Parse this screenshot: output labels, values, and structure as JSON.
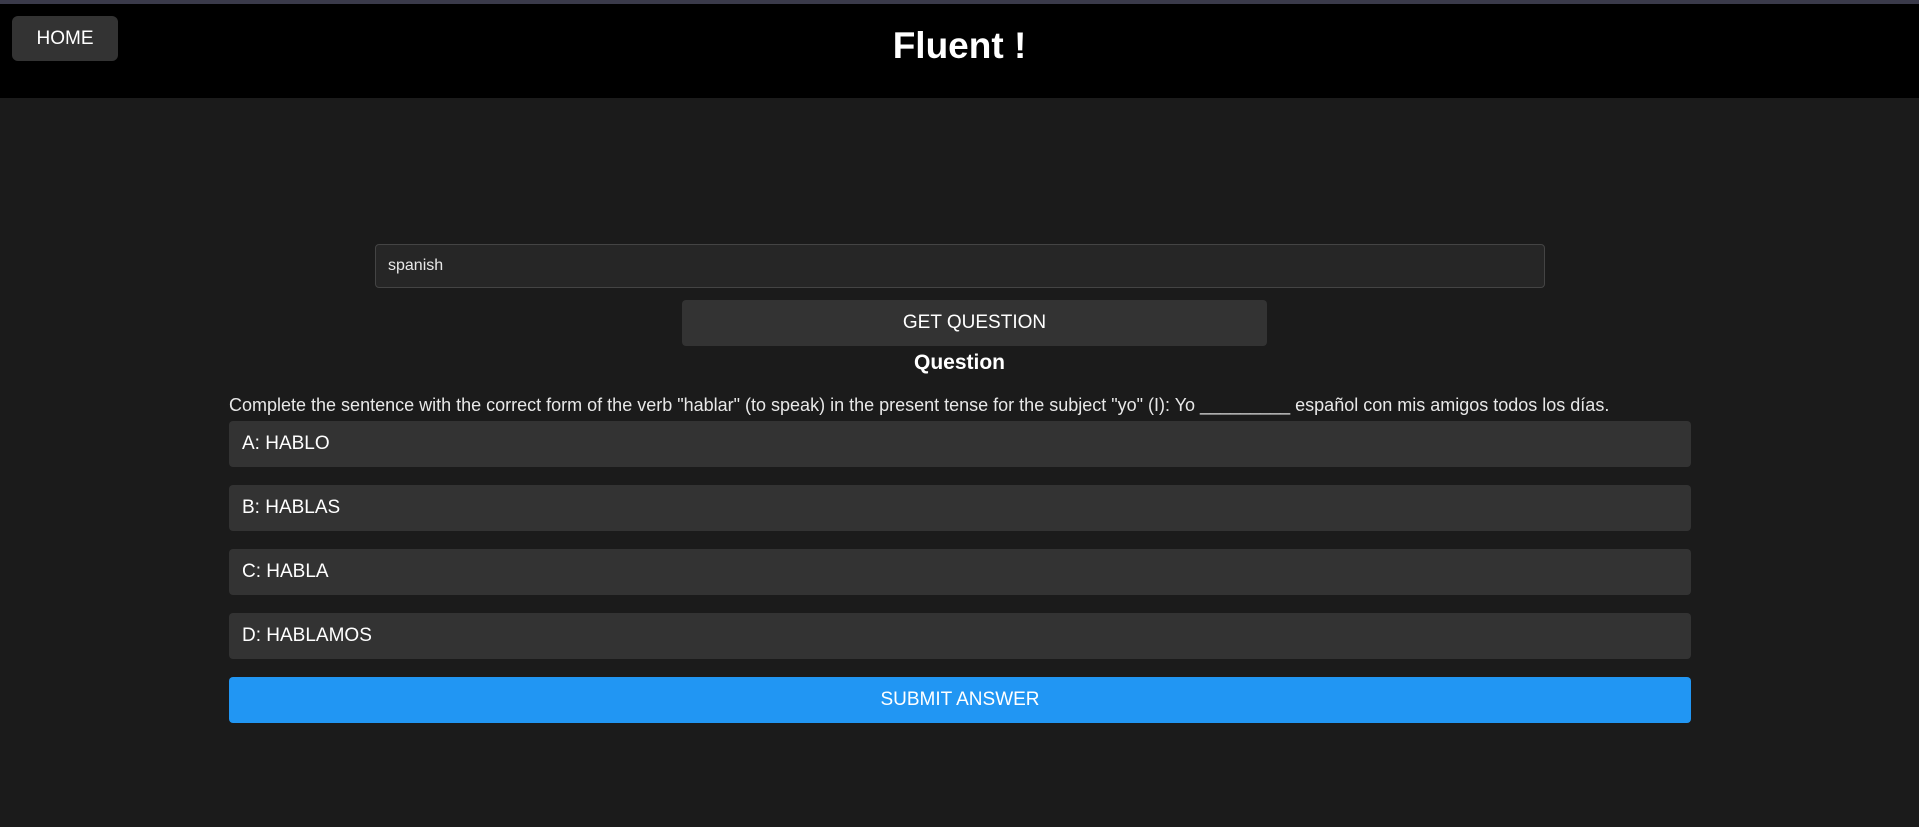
{
  "header": {
    "home_label": "HOME",
    "title": "Fluent !"
  },
  "language_input": {
    "value": "spanish"
  },
  "get_question_label": "GET QUESTION",
  "question": {
    "heading": "Question",
    "text": "Complete the sentence with the correct form of the verb \"hablar\" (to speak) in the present tense for the subject \"yo\" (I): Yo _________ español con mis amigos todos los días.",
    "options": [
      {
        "label": "A: HABLO"
      },
      {
        "label": "B: HABLAS"
      },
      {
        "label": "C: HABLA"
      },
      {
        "label": "D: HABLAMOS"
      }
    ]
  },
  "submit_label": "SUBMIT ANSWER",
  "colors": {
    "header_bg": "#000000",
    "page_bg": "#1b1b1b",
    "button_bg": "#333333",
    "submit_bg": "#2196f3"
  }
}
